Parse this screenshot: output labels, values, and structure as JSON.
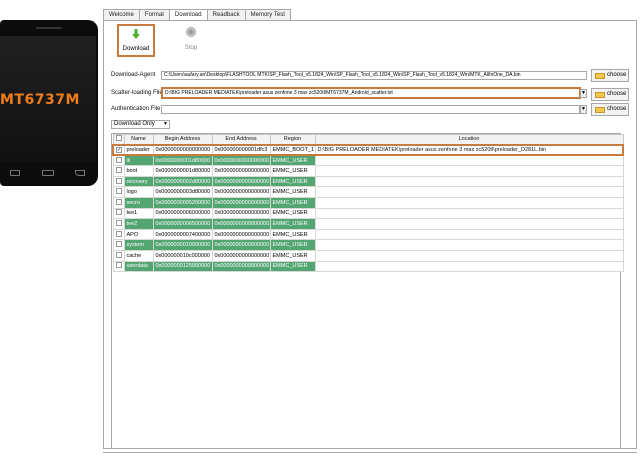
{
  "device": {
    "chip_label": "MT6737M"
  },
  "tabs": [
    {
      "label": "Welcome"
    },
    {
      "label": "Format"
    },
    {
      "label": "Download"
    },
    {
      "label": "Readback"
    },
    {
      "label": "Memory Test"
    }
  ],
  "toolbar": {
    "download_label": "Download",
    "stop_label": "Stop"
  },
  "download_agent": {
    "label": "Download-Agent",
    "value": "C:\\Users\\aufary.an\\Desktop\\FLASHTOOL MTK\\SP_Flash_Tool_v5.1824_Win\\SP_Flash_Tool_v5.1824_Win\\SP_Flash_Tool_v5.1824_Win\\MTK_AllInOne_DA.bin"
  },
  "scatter_file": {
    "label": "Scatter-loading File",
    "value": "D:\\BIG PRELOADER MEDIATEK\\preloader asus zenfone 3 max zc520tl\\MT6737M_Android_scatter.txt"
  },
  "auth_file": {
    "label": "Authentication File",
    "value": ""
  },
  "choose_label": "choose",
  "mode_select": {
    "value": "Download Only"
  },
  "table": {
    "columns": [
      "",
      "Name",
      "Begin Address",
      "End Address",
      "Region",
      "Location"
    ],
    "rows": [
      {
        "checked": true,
        "name": "preloader",
        "begin": "0x0000000000000000",
        "end": "0x000000000001dfc3",
        "region": "EMMC_BOOT_1",
        "location": "D:\\BIG PRELOADER MEDIATEK\\preloader asus zenfone 3 max zc520tl\\preloader_D281L.bin",
        "green": false
      },
      {
        "checked": false,
        "name": "lk",
        "begin": "0x0000000001d80000",
        "end": "0x0000000000000000",
        "region": "EMMC_USER",
        "location": "",
        "green": true
      },
      {
        "checked": false,
        "name": "boot",
        "begin": "0x0000000001d80000",
        "end": "0x0000000000000000",
        "region": "EMMC_USER",
        "location": "",
        "green": false
      },
      {
        "checked": false,
        "name": "recovery",
        "begin": "0x0000000002d80000",
        "end": "0x0000000000000000",
        "region": "EMMC_USER",
        "location": "",
        "green": true
      },
      {
        "checked": false,
        "name": "logo",
        "begin": "0x0000000003d80000",
        "end": "0x0000000000000000",
        "region": "EMMC_USER",
        "location": "",
        "green": false
      },
      {
        "checked": false,
        "name": "secro",
        "begin": "0x0000000005200000",
        "end": "0x0000000000000000",
        "region": "EMMC_USER",
        "location": "",
        "green": true
      },
      {
        "checked": false,
        "name": "tee1",
        "begin": "0x0000000006000000",
        "end": "0x0000000000000000",
        "region": "EMMC_USER",
        "location": "",
        "green": false
      },
      {
        "checked": false,
        "name": "tee2",
        "begin": "0x0000000006500000",
        "end": "0x0000000000000000",
        "region": "EMMC_USER",
        "location": "",
        "green": true
      },
      {
        "checked": false,
        "name": "APO",
        "begin": "0x0000000007400000",
        "end": "0x0000000000000000",
        "region": "EMMC_USER",
        "location": "",
        "green": false
      },
      {
        "checked": false,
        "name": "system",
        "begin": "0x0000000010000000",
        "end": "0x0000000000000000",
        "region": "EMMC_USER",
        "location": "",
        "green": true
      },
      {
        "checked": false,
        "name": "cache",
        "begin": "0x000000010c000000",
        "end": "0x0000000000000000",
        "region": "EMMC_USER",
        "location": "",
        "green": false
      },
      {
        "checked": false,
        "name": "userdata",
        "begin": "0x0000000125000000",
        "end": "0x0000000000000000",
        "region": "EMMC_USER",
        "location": "",
        "green": true
      }
    ]
  }
}
